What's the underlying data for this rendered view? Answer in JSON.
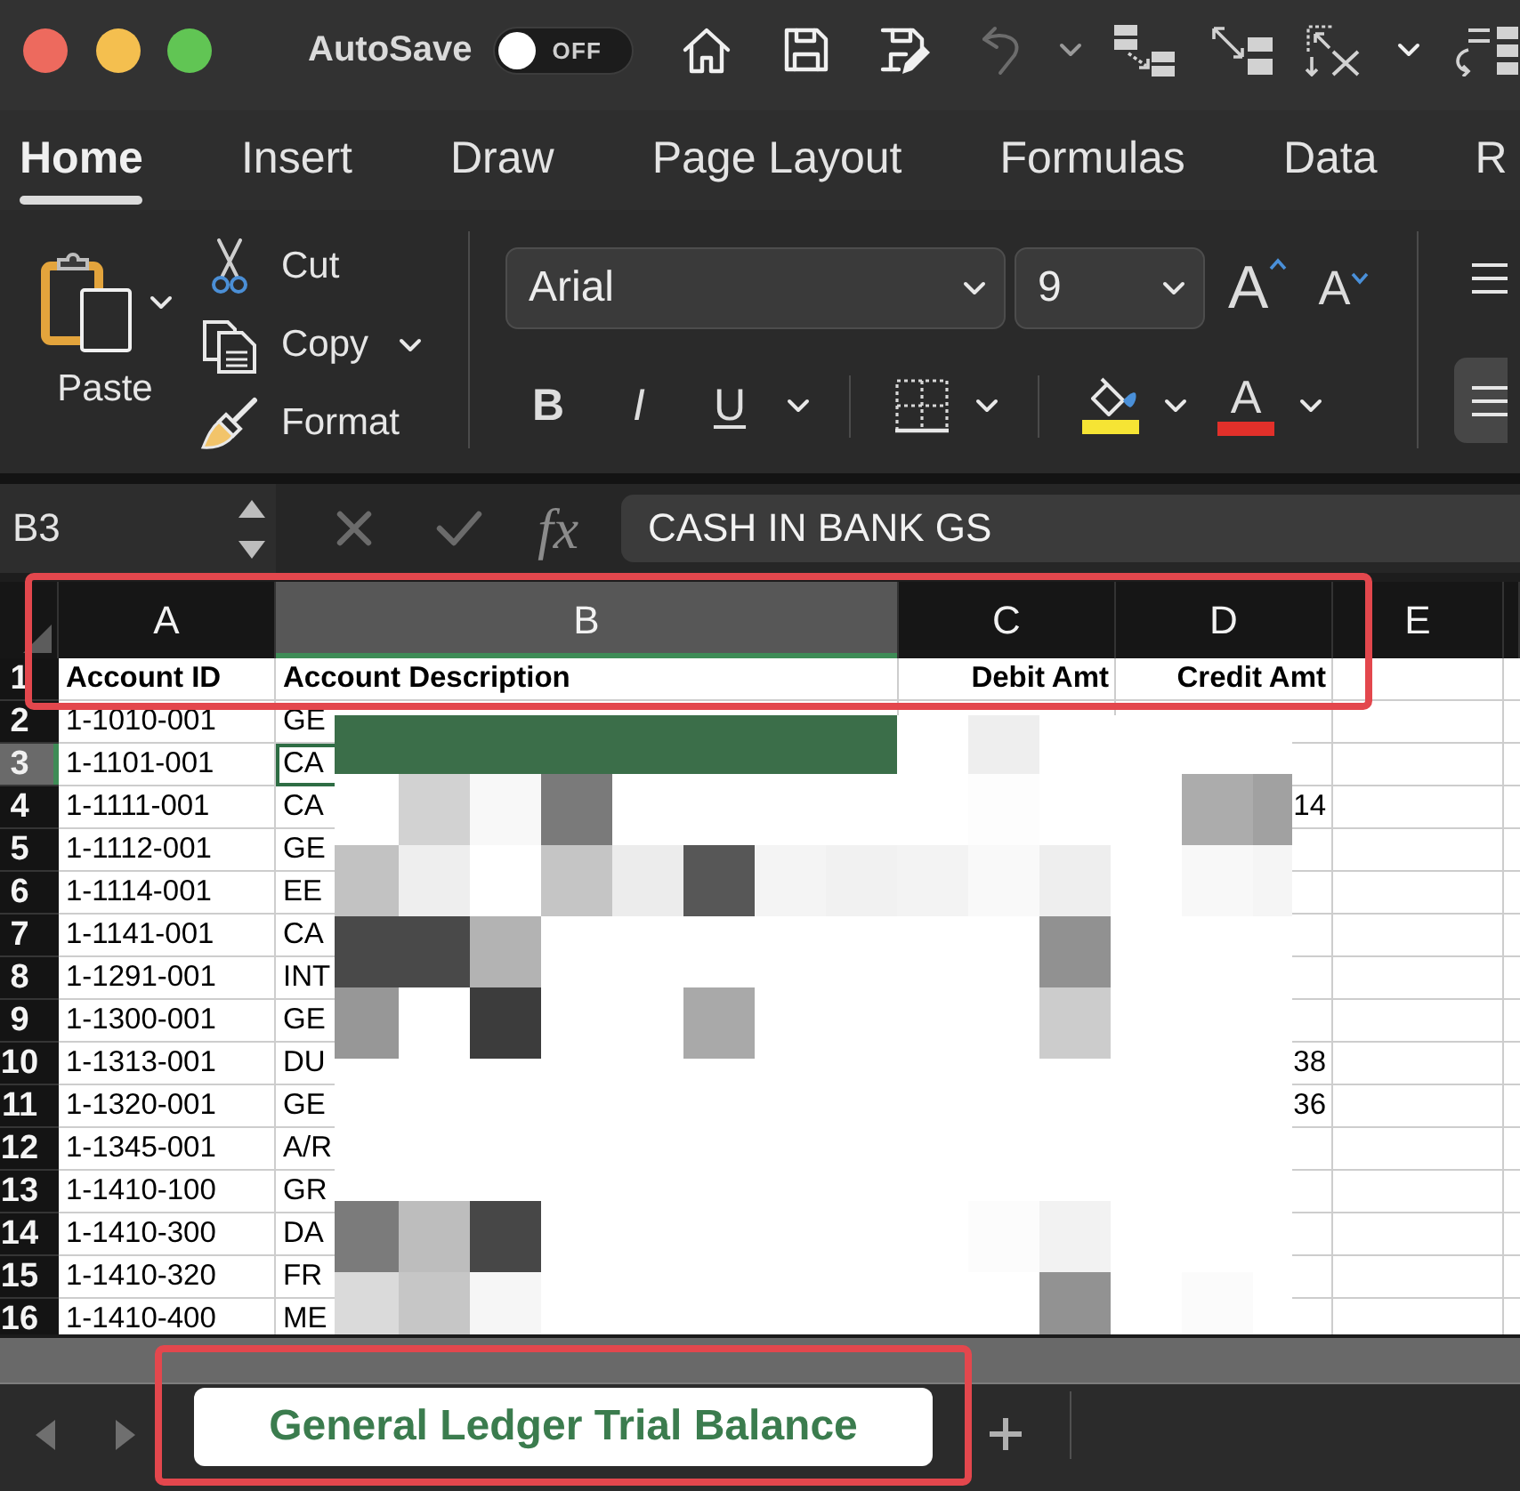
{
  "autosave": {
    "label": "AutoSave",
    "on": false,
    "state_label": "OFF"
  },
  "undo": {
    "disabled": true
  },
  "ribbon_tabs": [
    {
      "label": "Home",
      "selected": true
    },
    {
      "label": "Insert",
      "selected": false
    },
    {
      "label": "Draw",
      "selected": false
    },
    {
      "label": "Page Layout",
      "selected": false
    },
    {
      "label": "Formulas",
      "selected": false
    },
    {
      "label": "Data",
      "selected": false
    },
    {
      "label": "R",
      "selected": false
    }
  ],
  "clipboard": {
    "paste": "Paste",
    "cut": "Cut",
    "copy": "Copy",
    "format": "Format"
  },
  "font": {
    "name": "Arial",
    "size": "9",
    "grow": "A",
    "shrink": "A",
    "styles": [
      {
        "kind": "bold",
        "glyph": "B"
      },
      {
        "kind": "italic",
        "glyph": "I"
      },
      {
        "kind": "underline",
        "glyph": "U"
      }
    ],
    "color_buttons": [
      {
        "kind": "fill_color",
        "color": "#f6e434"
      },
      {
        "kind": "font_color",
        "glyph": "A",
        "color": "#e2302a"
      }
    ]
  },
  "alignment": [
    {
      "selected": false
    },
    {
      "selected": true
    }
  ],
  "formula_bar": {
    "name_box": "B3",
    "function_button": "fx",
    "value": "CASH IN BANK GS"
  },
  "sheet": {
    "columns": [
      {
        "label": "A",
        "selected": false
      },
      {
        "label": "B",
        "selected": true
      },
      {
        "label": "C",
        "selected": false
      },
      {
        "label": "D",
        "selected": false
      },
      {
        "label": "E",
        "selected": false
      }
    ],
    "rows": [
      {
        "label": "1",
        "selected": false,
        "kind": "heading",
        "cells": {
          "a": "Account ID",
          "b": "Account Description",
          "c": "Debit Amt",
          "d": "Credit Amt"
        }
      },
      {
        "label": "2",
        "selected": false,
        "kind": "data",
        "cells": {
          "a": "1-1010-001",
          "b": "GE"
        }
      },
      {
        "label": "3",
        "selected": true,
        "kind": "data",
        "cells": {
          "a": "1-1101-001",
          "b": "CA"
        }
      },
      {
        "label": "4",
        "selected": false,
        "kind": "data",
        "cells": {
          "a": "1-1111-001",
          "b": "CA",
          "d": "14"
        }
      },
      {
        "label": "5",
        "selected": false,
        "kind": "data",
        "cells": {
          "a": "1-1112-001",
          "b": "GE"
        }
      },
      {
        "label": "6",
        "selected": false,
        "kind": "data",
        "cells": {
          "a": "1-1114-001",
          "b": "EE"
        }
      },
      {
        "label": "7",
        "selected": false,
        "kind": "data",
        "cells": {
          "a": "1-1141-001",
          "b": "CA"
        }
      },
      {
        "label": "8",
        "selected": false,
        "kind": "data",
        "cells": {
          "a": "1-1291-001",
          "b": "INT"
        }
      },
      {
        "label": "9",
        "selected": false,
        "kind": "data",
        "cells": {
          "a": "1-1300-001",
          "b": "GE"
        }
      },
      {
        "label": "10",
        "selected": false,
        "kind": "data",
        "cells": {
          "a": "1-1313-001",
          "b": "DU",
          "d": "38"
        }
      },
      {
        "label": "11",
        "selected": false,
        "kind": "data",
        "cells": {
          "a": "1-1320-001",
          "b": "GE",
          "d": "36"
        }
      },
      {
        "label": "12",
        "selected": false,
        "kind": "data",
        "cells": {
          "a": "1-1345-001",
          "b": "A/R"
        }
      },
      {
        "label": "13",
        "selected": false,
        "kind": "data",
        "cells": {
          "a": "1-1410-100",
          "b": "GR"
        }
      },
      {
        "label": "14",
        "selected": false,
        "kind": "data",
        "cells": {
          "a": "1-1410-300",
          "b": "DA"
        }
      },
      {
        "label": "15",
        "selected": false,
        "kind": "data",
        "cells": {
          "a": "1-1410-320",
          "b": "FR"
        }
      },
      {
        "label": "16",
        "selected": false,
        "kind": "data",
        "cells": {
          "a": "1-1410-400",
          "b": "ME"
        }
      }
    ]
  },
  "sheet_tabs": [
    {
      "label": "General Ledger Trial Balance",
      "selected": true
    }
  ]
}
